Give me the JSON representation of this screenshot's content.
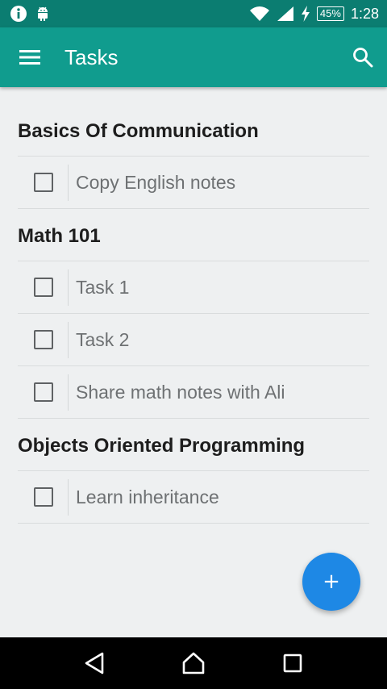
{
  "status_bar": {
    "battery": "45%",
    "time": "1:28",
    "icons": [
      "info-icon",
      "android-icon",
      "wifi-icon",
      "signal-icon",
      "charging-icon",
      "battery-icon"
    ]
  },
  "app_bar": {
    "title": "Tasks",
    "menu_icon": "hamburger-menu-icon",
    "search_icon": "search-icon"
  },
  "groups": [
    {
      "title": "Basics Of Communication",
      "tasks": [
        {
          "label": "Copy English notes",
          "checked": false
        }
      ]
    },
    {
      "title": "Math 101",
      "tasks": [
        {
          "label": "Task 1",
          "checked": false
        },
        {
          "label": "Task 2",
          "checked": false
        },
        {
          "label": "Share math notes with Ali",
          "checked": false
        }
      ]
    },
    {
      "title": "Objects Oriented Programming",
      "tasks": [
        {
          "label": "Learn inheritance",
          "checked": false
        }
      ]
    }
  ],
  "fab": {
    "label": "+"
  },
  "colors": {
    "status_bar": "#0b7d71",
    "app_bar": "#109c8e",
    "fab": "#1e88e5",
    "background": "#eef0f1"
  }
}
